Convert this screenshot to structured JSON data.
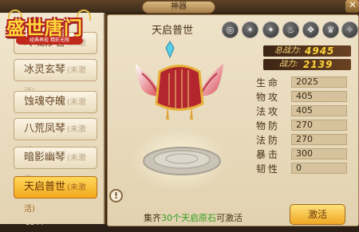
{
  "header": {
    "title": "神器",
    "close_icon": "close-icon"
  },
  "logo": {
    "title": "盛世唐门",
    "tagline": "经典再现 精彩无限"
  },
  "list": [
    {
      "name": "玲珑妙音",
      "status": "(未激活)",
      "selected": false
    },
    {
      "name": "冰灵玄琴",
      "status": "(未激活)",
      "selected": false
    },
    {
      "name": "蚀魂夺魄",
      "status": "(未激活)",
      "selected": false
    },
    {
      "name": "八荒凤琴",
      "status": "(未激活)",
      "selected": false
    },
    {
      "name": "暗影幽琴",
      "status": "(未激活)",
      "selected": false
    },
    {
      "name": "天启普世",
      "status": "(未激活)",
      "selected": true
    }
  ],
  "weapon": {
    "name": "天启普世"
  },
  "skills": [
    "swirl-icon",
    "dragon-icon",
    "beast-icon",
    "flame-icon",
    "wing-icon",
    "crown-icon",
    "bird-icon"
  ],
  "power": {
    "total_label": "总战力:",
    "total_value": "4945",
    "label": "战力:",
    "value": "2139"
  },
  "stats": [
    {
      "label": "生命",
      "value": "2025"
    },
    {
      "label": "物攻",
      "value": "405"
    },
    {
      "label": "法攻",
      "value": "405"
    },
    {
      "label": "物防",
      "value": "270"
    },
    {
      "label": "法防",
      "value": "270"
    },
    {
      "label": "暴击",
      "value": "300"
    },
    {
      "label": "韧性",
      "value": "0"
    }
  ],
  "hint": {
    "icon": "!",
    "prefix": "集齐",
    "highlight": "30个天启原石",
    "suffix": "可激活"
  },
  "button": {
    "label": "激活"
  },
  "footer": {
    "arrow": "◂",
    "number": "3344"
  }
}
